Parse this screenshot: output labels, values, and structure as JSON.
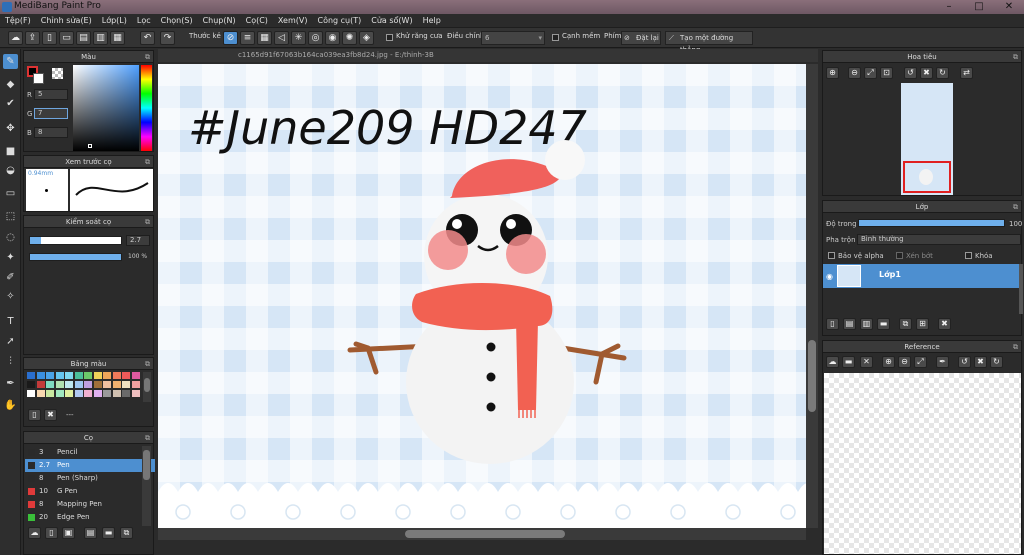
{
  "window": {
    "title": "MediBang Paint Pro"
  },
  "menu": [
    "Tệp(F)",
    "Chỉnh sửa(E)",
    "Lớp(L)",
    "Lọc",
    "Chọn(S)",
    "Chụp(N)",
    "Cọ(C)",
    "Xem(V)",
    "Công cụ(T)",
    "Cửa sổ(W)",
    "Help"
  ],
  "toolbar": {
    "ruler_label": "Thước kẻ",
    "antialias_label": "Khử răng cưa",
    "adjust_label": "Điều chỉnh",
    "adjust_value": "6",
    "smooth_label": "Cạnh mềm",
    "key_label": "Phím",
    "reset_label": "Đặt lại",
    "line_label": "Tạo một đường thẳng"
  },
  "color_panel": {
    "title": "Màu",
    "r_label": "R",
    "r_value": "5",
    "g_label": "G",
    "g_value": "7",
    "b_label": "B",
    "b_value": "8"
  },
  "preview_panel": {
    "title": "Xem trước cọ",
    "size": "0.94mm"
  },
  "brush_control": {
    "title": "Kiểm soát cọ",
    "size_value": "2.7",
    "size_fill": 0.12,
    "opacity_value": "100 %"
  },
  "palette": {
    "title": "Bảng màu",
    "name": "---",
    "swatches": [
      "#2a6fcf",
      "#3a8fe0",
      "#4aa3e8",
      "#66c6ef",
      "#7fd9f0",
      "#4bbf9a",
      "#6cc96a",
      "#f0d25a",
      "#f0a65a",
      "#f07a5a",
      "#f05a5a",
      "#e05aa0",
      "#1a1a1a",
      "#c43a3a",
      "#7fd9c0",
      "#b0e0b0",
      "#c0e8f0",
      "#a0c8f0",
      "#c0a0e0",
      "#a0703a",
      "#f0c0a0",
      "#f0b070",
      "#f0e0c0",
      "#f0a0a0",
      "#ffffff",
      "#f8d8b0",
      "#c8e8a0",
      "#a0e8c0",
      "#e0f0a0",
      "#b0c8f0",
      "#f0b0d0",
      "#e0b0f0",
      "#9a9a9a",
      "#d0c0b0",
      "#6a6a6a",
      "#f0c0c0"
    ]
  },
  "brush_panel": {
    "title": "Cọ",
    "items": [
      {
        "size": "3",
        "name": "Pencil",
        "color": "#2a2a2a"
      },
      {
        "size": "2.7",
        "name": "Pen",
        "color": "#2a2a2a"
      },
      {
        "size": "8",
        "name": "Pen (Sharp)",
        "color": "#2a2a2a"
      },
      {
        "size": "10",
        "name": "G Pen",
        "color": "#e03a3a"
      },
      {
        "size": "8",
        "name": "Mapping Pen",
        "color": "#e03a3a"
      },
      {
        "size": "20",
        "name": "Edge Pen",
        "color": "#3ac03a"
      }
    ]
  },
  "canvas": {
    "filename": "c1165d91f67063b164ca039ea3fb8d24.jpg - E:/thinh-3B",
    "handwriting": "#June209 HD247"
  },
  "navigator": {
    "title": "Hoa tiêu"
  },
  "layer_panel": {
    "title": "Lớp",
    "opacity_label": "Độ trong",
    "opacity_value": "100",
    "blend_label": "Pha trộn",
    "blend_value": "Bình thường",
    "protect_alpha": "Bảo vệ alpha",
    "clipping": "Xén bớt",
    "lock": "Khóa",
    "layer_name": "Lớp1"
  },
  "reference": {
    "title": "Reference"
  }
}
